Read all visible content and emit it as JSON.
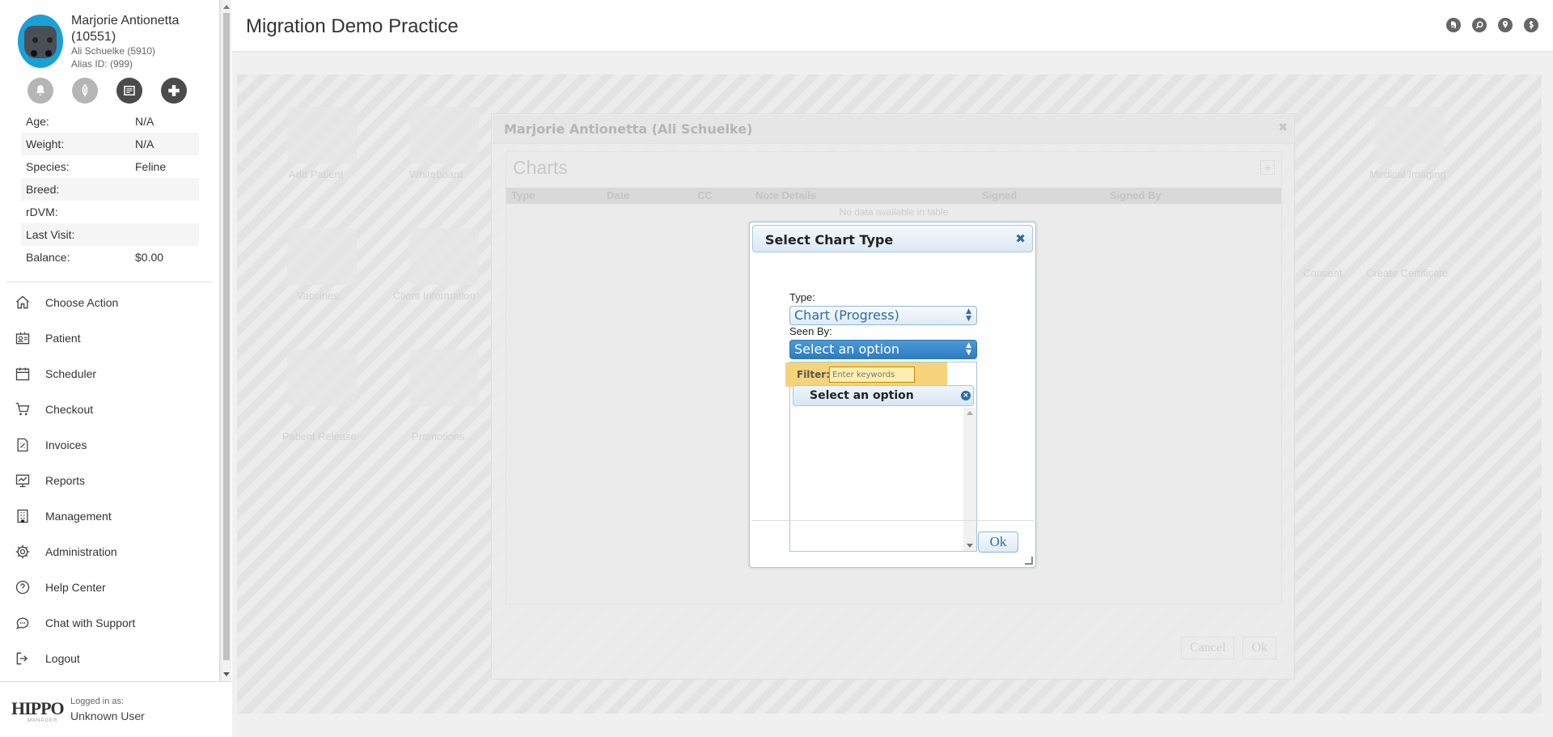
{
  "patient": {
    "name": "Marjorie Antionetta (10551)",
    "owner": "Ali Schuelke (5910)",
    "alias": "Alias ID: (999)",
    "info": [
      {
        "label": "Age:",
        "value": "N/A"
      },
      {
        "label": "Weight:",
        "value": "N/A"
      },
      {
        "label": "Species:",
        "value": "Feline"
      },
      {
        "label": "Breed:",
        "value": ""
      },
      {
        "label": "rDVM:",
        "value": ""
      },
      {
        "label": "Last Visit:",
        "value": ""
      },
      {
        "label": "Balance:",
        "value": "$0.00"
      }
    ]
  },
  "nav": {
    "items": [
      {
        "label": "Choose Action",
        "icon": "home-icon"
      },
      {
        "label": "Patient",
        "icon": "patient-card-icon"
      },
      {
        "label": "Scheduler",
        "icon": "calendar-icon"
      },
      {
        "label": "Checkout",
        "icon": "cart-icon"
      },
      {
        "label": "Invoices",
        "icon": "invoice-icon"
      },
      {
        "label": "Reports",
        "icon": "reports-icon"
      },
      {
        "label": "Management",
        "icon": "building-icon"
      },
      {
        "label": "Administration",
        "icon": "gear-icon"
      },
      {
        "label": "Help Center",
        "icon": "help-icon"
      },
      {
        "label": "Chat with Support",
        "icon": "chat-icon"
      },
      {
        "label": "Logout",
        "icon": "logout-icon"
      }
    ]
  },
  "footer": {
    "logo": "HIPPO",
    "logo_sub": "MANAGER",
    "logged_in_label": "Logged in as:",
    "user": "Unknown User"
  },
  "header": {
    "title": "Migration Demo Practice"
  },
  "background": {
    "tiles": [
      "Add Patient",
      "Whiteboard",
      "Vaccines",
      "Client Information",
      "Patient Release",
      "Promotions",
      "Medical Imaging",
      "Consent",
      "Create Certificate"
    ]
  },
  "patient_dialog": {
    "title": "Marjorie Antionetta (Ali Schuelke)",
    "charts_title": "Charts",
    "columns": [
      "Type",
      "Date",
      "CC",
      "Note Details",
      "Signed",
      "Signed By"
    ],
    "empty": "No data available in table",
    "cancel": "Cancel",
    "ok": "Ok"
  },
  "chart_type_dialog": {
    "title": "Select Chart Type",
    "type_label": "Type:",
    "type_value": "Chart (Progress)",
    "seen_by_label": "Seen By:",
    "seen_by_value": "Select an option",
    "filter_label": "Filter:",
    "filter_placeholder": "Enter keywords",
    "option_selected": "Select an option",
    "ok": "Ok"
  },
  "colors": {
    "accent": "#2e7cc2",
    "dialog_border": "#a6c9e2",
    "filter_highlight": "#f5d37a"
  }
}
